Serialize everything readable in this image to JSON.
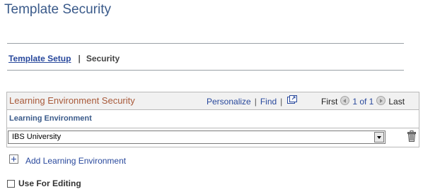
{
  "page": {
    "title": "Template Security"
  },
  "subnav": {
    "items": [
      {
        "label": "Template Setup",
        "active": false
      },
      {
        "label": "Security",
        "active": true
      }
    ],
    "separator": "|"
  },
  "grid": {
    "title": "Learning Environment Security",
    "tools": {
      "personalize": "Personalize",
      "find": "Find",
      "separator": "|",
      "view_all_icon": "view-all-icon"
    },
    "nav": {
      "first": "First",
      "count": "1 of 1",
      "last": "Last",
      "prev_icon": "prev-icon",
      "next_icon": "next-icon"
    },
    "columns": [
      "Learning Environment"
    ],
    "rows": [
      {
        "learning_environment": "IBS University"
      }
    ],
    "delete_icon": "trash-icon"
  },
  "actions": {
    "add_label": "Add Learning Environment",
    "add_icon": "plus-icon"
  },
  "options": {
    "use_for_editing_label": "Use For Editing",
    "use_for_editing_checked": false
  },
  "colors": {
    "title": "#3a5a8a",
    "link": "#28489c",
    "grid_title": "#a85a3a",
    "grid_header_bg": "#f1f1f1",
    "border": "#b9b9b9"
  }
}
